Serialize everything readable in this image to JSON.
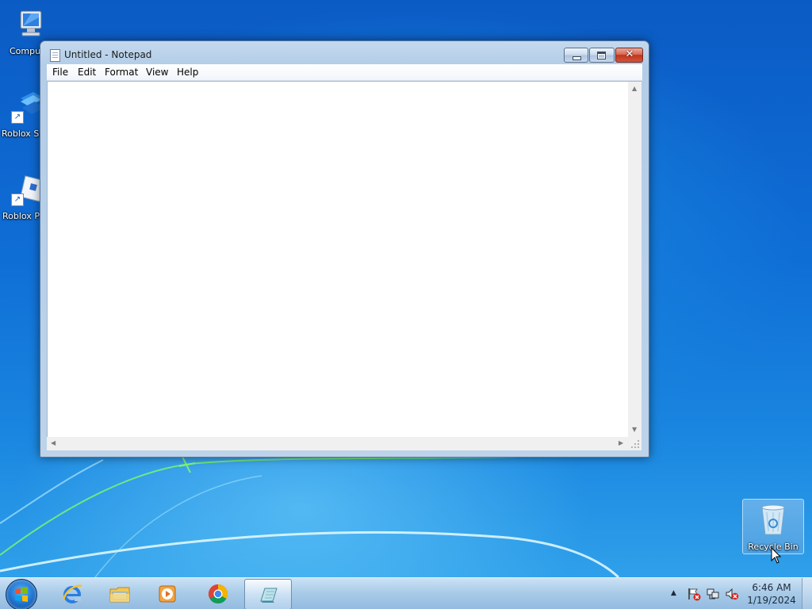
{
  "desktop": {
    "icons": [
      {
        "label": "Computer",
        "icon": "computer-icon"
      },
      {
        "label": "Roblox Studio",
        "icon": "roblox-studio-icon"
      },
      {
        "label": "Roblox Player",
        "icon": "roblox-player-icon"
      },
      {
        "label": "Recycle Bin",
        "icon": "recycle-bin-icon"
      }
    ]
  },
  "notepad": {
    "title": "Untitled - Notepad",
    "menu": [
      "File",
      "Edit",
      "Format",
      "View",
      "Help"
    ],
    "content": ""
  },
  "taskbar": {
    "pinned": [
      {
        "icon": "internet-explorer-icon"
      },
      {
        "icon": "windows-explorer-icon"
      },
      {
        "icon": "media-player-icon"
      },
      {
        "icon": "chrome-icon"
      },
      {
        "icon": "notepad-icon",
        "active": true
      }
    ],
    "clock": {
      "time": "6:46 AM",
      "date": "1/19/2024"
    }
  },
  "colors": {
    "desktop_top": "#0b5bc4",
    "desktop_bottom": "#2fa0ea",
    "close_button": "#c2351c",
    "taskbar": "#a9cbe8"
  }
}
